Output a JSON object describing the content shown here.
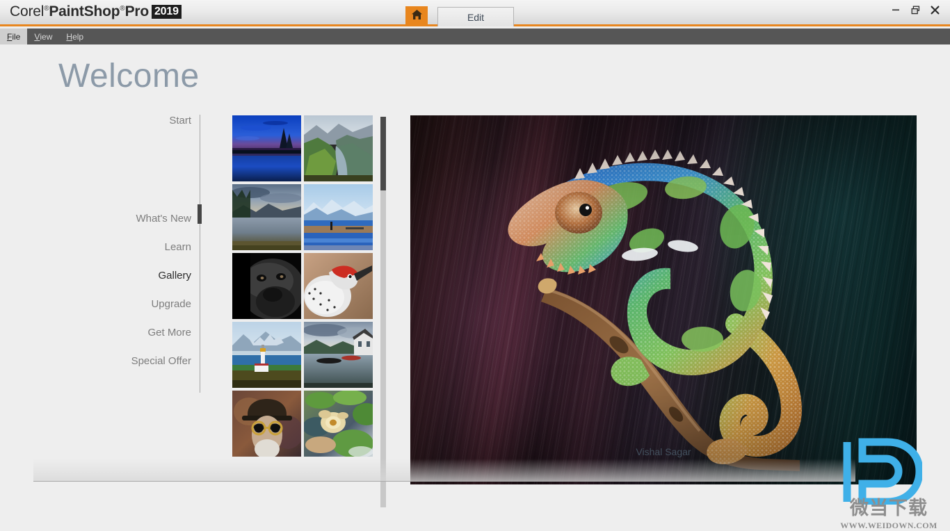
{
  "titlebar": {
    "brand_corel": "Corel",
    "brand_reg1": "®",
    "brand_paintshop": "PaintShop",
    "brand_reg2": "®",
    "brand_pro": "Pro",
    "brand_year": "2019",
    "home_icon": "home-icon",
    "edit_tab_label": "Edit",
    "minimize_icon": "minimize-icon",
    "restore_icon": "restore-icon",
    "close_icon": "close-icon"
  },
  "menubar": {
    "items": [
      {
        "label": "File",
        "mnemonic": "F",
        "rest": "ile",
        "active": true
      },
      {
        "label": "View",
        "mnemonic": "V",
        "rest": "iew",
        "active": false
      },
      {
        "label": "Help",
        "mnemonic": "H",
        "rest": "elp",
        "active": false
      }
    ]
  },
  "page": {
    "title": "Welcome"
  },
  "nav": {
    "items": [
      {
        "label": "Start",
        "active": false
      },
      {
        "label": "What's New",
        "active": false
      },
      {
        "label": "Learn",
        "active": false
      },
      {
        "label": "Gallery",
        "active": true
      },
      {
        "label": "Upgrade",
        "active": false
      },
      {
        "label": "Get More",
        "active": false
      },
      {
        "label": "Special Offer",
        "active": false
      }
    ]
  },
  "gallery": {
    "thumbnails": [
      {
        "name": "blue-dusk-lake-reflection"
      },
      {
        "name": "green-fjord-valley"
      },
      {
        "name": "mountain-lake-clouds-reflection"
      },
      {
        "name": "snow-mountain-lake-person"
      },
      {
        "name": "gorilla-black-and-white-portrait"
      },
      {
        "name": "red-bellied-woodpecker"
      },
      {
        "name": "lighthouse-coastal-mountains"
      },
      {
        "name": "lake-boats-cottage"
      },
      {
        "name": "steampunk-man-goggles-tophat"
      },
      {
        "name": "water-lily-leaves-pond"
      }
    ],
    "scrollbar": {
      "name": "gallery-scrollbar"
    }
  },
  "preview": {
    "image_name": "panther-chameleon-on-branch",
    "caption": "Vishal Sagar"
  },
  "watermark": {
    "logo_name": "weidown-d-logo",
    "chinese_text": "微当下载",
    "url_text": "WWW.WEIDOWN.COM"
  },
  "colors": {
    "accent_orange": "#e8861e",
    "menubar_bg": "#565656",
    "page_bg": "#eeeeee",
    "nav_active": "#2b2b2b",
    "nav_inactive": "#7d7d7d",
    "welcome_title": "#8c9aa8",
    "watermark_blue": "#36a9e0",
    "scroll_thumb": "#4a4a4a"
  }
}
